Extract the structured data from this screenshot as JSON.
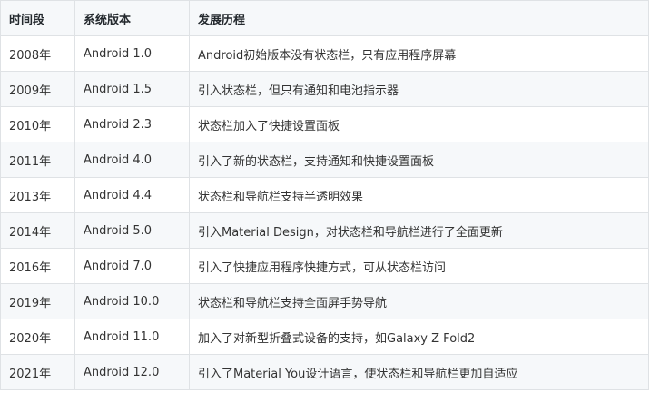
{
  "table": {
    "headers": [
      "时间段",
      "系统版本",
      "发展历程"
    ],
    "rows": [
      [
        "2008年",
        "Android 1.0",
        "Android初始版本没有状态栏，只有应用程序屏幕"
      ],
      [
        "2009年",
        "Android 1.5",
        "引入状态栏，但只有通知和电池指示器"
      ],
      [
        "2010年",
        "Android 2.3",
        "状态栏加入了快捷设置面板"
      ],
      [
        "2011年",
        "Android 4.0",
        "引入了新的状态栏，支持通知和快捷设置面板"
      ],
      [
        "2013年",
        "Android 4.4",
        "状态栏和导航栏支持半透明效果"
      ],
      [
        "2014年",
        "Android 5.0",
        "引入Material Design，对状态栏和导航栏进行了全面更新"
      ],
      [
        "2016年",
        "Android 7.0",
        "引入了快捷应用程序快捷方式，可从状态栏访问"
      ],
      [
        "2019年",
        "Android 10.0",
        "状态栏和导航栏支持全面屏手势导航"
      ],
      [
        "2020年",
        "Android 11.0",
        "加入了对新型折叠式设备的支持，如Galaxy Z Fold2"
      ],
      [
        "2021年",
        "Android 12.0",
        "引入了Material You设计语言，使状态栏和导航栏更加自适应"
      ]
    ]
  }
}
